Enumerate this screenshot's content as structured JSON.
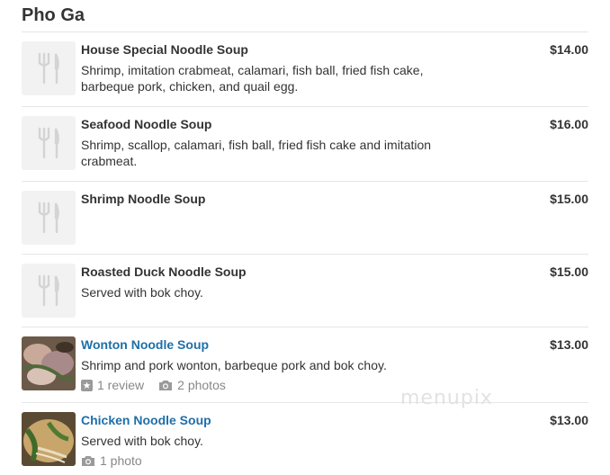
{
  "section": {
    "title": "Pho Ga"
  },
  "items": [
    {
      "name": "House Special Noodle Soup",
      "price": "$14.00",
      "description": "Shrimp, imitation crabmeat, calamari, fish ball, fried fish cake, barbeque pork, chicken, and quail egg."
    },
    {
      "name": "Seafood Noodle Soup",
      "price": "$16.00",
      "description": "Shrimp, scallop, calamari, fish ball, fried fish cake and imitation crabmeat."
    },
    {
      "name": "Shrimp Noodle Soup",
      "price": "$15.00"
    },
    {
      "name": "Roasted Duck Noodle Soup",
      "price": "$15.00",
      "description": "Served with bok choy."
    },
    {
      "name": "Wonton Noodle Soup",
      "price": "$13.00",
      "description": "Shrimp and pork wonton, barbeque pork and bok choy.",
      "reviews": "1 review",
      "photos": "2 photos"
    },
    {
      "name": "Chicken Noodle Soup",
      "price": "$13.00",
      "description": "Served with bok choy.",
      "photos": "1 photo"
    }
  ],
  "icons": {
    "placeholder": "fork-knife-icon",
    "review": "star-icon",
    "photo": "camera-icon"
  },
  "colors": {
    "link": "#1f6fa8",
    "text": "#333333",
    "muted": "#888888",
    "divider": "#e6e6e6",
    "placeholder_bg": "#f2f2f2"
  },
  "watermark": "menupix"
}
